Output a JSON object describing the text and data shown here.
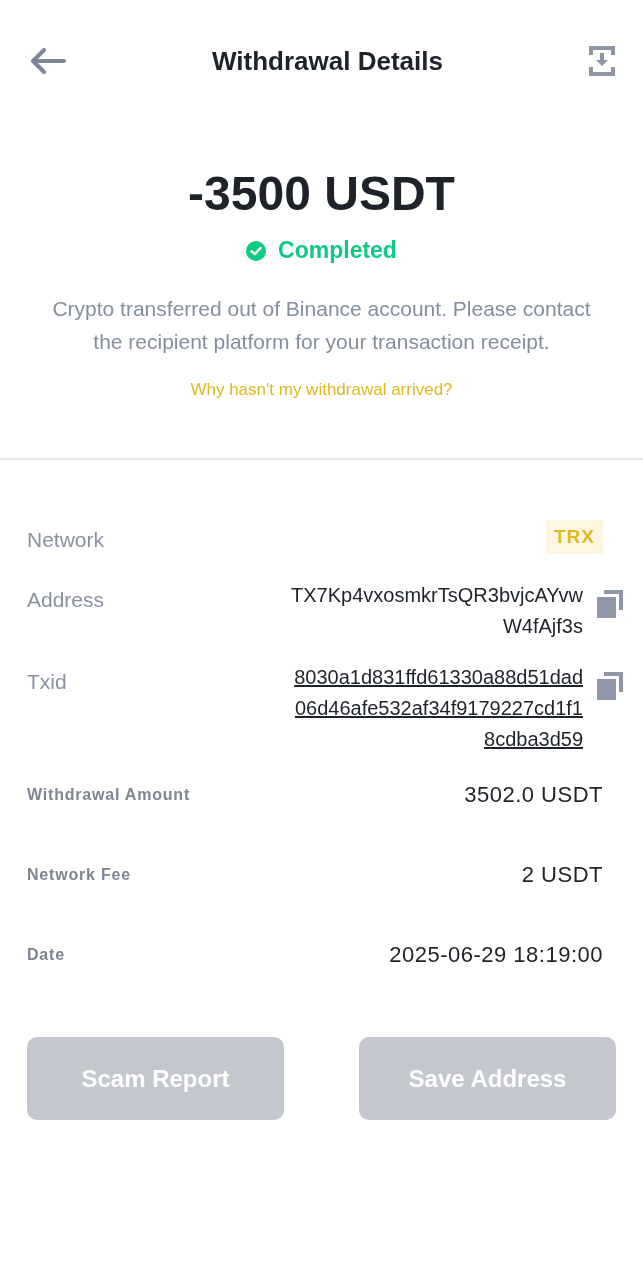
{
  "header": {
    "title": "Withdrawal Details"
  },
  "summary": {
    "amount": "-3500 USDT",
    "status": "Completed",
    "completed": true,
    "description": "Crypto transferred out of Binance account. Please contact the recipient platform for your transaction receipt.",
    "help_link": "Why hasn't my withdrawal arrived?"
  },
  "details": [
    {
      "kind": "tag",
      "label": "Network",
      "lines": [
        "TRX"
      ]
    },
    {
      "kind": "copy",
      "label": "Address",
      "lines": [
        "TX7Kp4vxosmkrTsQR3bvjcAYvw",
        "W4fAjf3s"
      ]
    },
    {
      "kind": "link",
      "label": "Txid",
      "lines": [
        "8030a1d831ffd61330a88d51dad",
        "06d46afe532af34f9179227cd1f1",
        "8cdba3d59"
      ]
    },
    {
      "kind": "plain",
      "label": "Withdrawal Amount",
      "lines": [
        "3502.0 USDT"
      ]
    },
    {
      "kind": "plain",
      "label": "Network Fee",
      "lines": [
        "2 USDT"
      ]
    },
    {
      "kind": "plain",
      "label": "Date",
      "lines": [
        "2025-06-29 18:19:00"
      ]
    }
  ],
  "buttons": [
    {
      "label": "Scam Report",
      "disabled": true
    },
    {
      "label": "Save Address",
      "disabled": true
    }
  ]
}
